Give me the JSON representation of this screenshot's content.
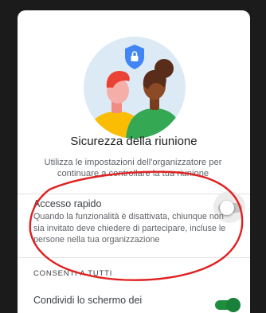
{
  "dialog": {
    "title": "Sicurezza della riunione",
    "description": "Utilizza le impostazioni dell'organizzatore per continuare a controllare la tua riunione"
  },
  "quick_access": {
    "label": "Accesso rapido",
    "description": "Quando la funzionalità è disattivata, chiunque non sia invitato deve chiedere di partecipare, incluse le persone nella tua organizzazione",
    "enabled": false
  },
  "allow_all": {
    "section_label": "CONSENTI A TUTTI",
    "share_screen_label": "Condividi lo schermo dei",
    "share_screen_enabled": true
  },
  "icons": {
    "shield": "shield-lock-icon"
  },
  "colors": {
    "shield": "#4285f4",
    "toggle_on": "#188038",
    "annotation": "#e02020"
  }
}
